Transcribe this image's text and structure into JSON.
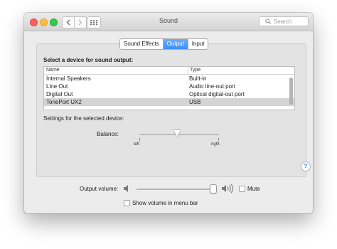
{
  "window": {
    "title": "Sound"
  },
  "toolbar": {
    "back_icon": "chevron-left-icon",
    "forward_icon": "chevron-right-icon",
    "show_all_icon": "grid-icon",
    "search_placeholder": "Search"
  },
  "tabs": [
    {
      "label": "Sound Effects",
      "active": false
    },
    {
      "label": "Output",
      "active": true
    },
    {
      "label": "Input",
      "active": false
    }
  ],
  "output": {
    "heading": "Select a device for sound output:",
    "columns": {
      "name": "Name",
      "type": "Type"
    },
    "devices": [
      {
        "name": "Internal Speakers",
        "type": "Built-in",
        "selected": false
      },
      {
        "name": "Line Out",
        "type": "Audio line-out port",
        "selected": false
      },
      {
        "name": "Digital Out",
        "type": "Optical digital-out port",
        "selected": false
      },
      {
        "name": "TonePort UX2",
        "type": "USB",
        "selected": true
      }
    ],
    "settings_label": "Settings for the selected device:",
    "balance": {
      "label": "Balance:",
      "left_label": "left",
      "right_label": "right",
      "value": 0.5
    }
  },
  "volume": {
    "label": "Output volume:",
    "level": 0.95,
    "mute_label": "Mute",
    "muted": false,
    "show_in_menu_bar_label": "Show volume in menu bar",
    "show_in_menu_bar": false
  },
  "help": {
    "label": "?"
  },
  "colors": {
    "accent": "#3f8ef5",
    "close": "#fc605c",
    "minimize": "#fdbc40",
    "zoom": "#34c84a"
  }
}
